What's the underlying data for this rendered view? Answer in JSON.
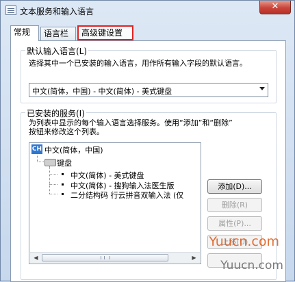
{
  "window": {
    "title": "文本服务和输入语言",
    "close_glyph": "✕"
  },
  "tabs": [
    {
      "label": "常规",
      "state": "active"
    },
    {
      "label": "语言栏",
      "state": "normal"
    },
    {
      "label": "高级键设置",
      "state": "highlighted"
    }
  ],
  "default_language": {
    "group_title": "默认输入语言(L)",
    "description": "选择其中一个已安装的输入语言，用作所有输入字段的默认语言。",
    "selected_value": "中文(简体，中国) - 中文(简体) - 美式键盘"
  },
  "installed_services": {
    "group_title": "已安装的服务(I)",
    "description_line1": "为列表中显示的每个输入语言选择服务。使用“添加”和“删除”",
    "description_line2": "按钮来修改这个列表。",
    "tree": {
      "language_badge": "CH",
      "language": "中文(简体，中国)",
      "category": "键盘",
      "items": [
        "中文(简体) - 美式键盘",
        "中文(简体) - 搜狗输入法医生版",
        "二分结构码 行云拼音双输入法 (仅"
      ]
    },
    "buttons": {
      "add": "添加(D)...",
      "remove": "删除(R)",
      "properties": "属性(P)...",
      "move_up": "上移(U)"
    }
  },
  "watermarks": {
    "primary": "Yuucn.com",
    "secondary": "Yuucn.com"
  },
  "colors": {
    "tab_highlight": "#e02222",
    "language_badge": "#2f76d0",
    "close_button": "#c9443a",
    "watermark": "#e06020"
  }
}
